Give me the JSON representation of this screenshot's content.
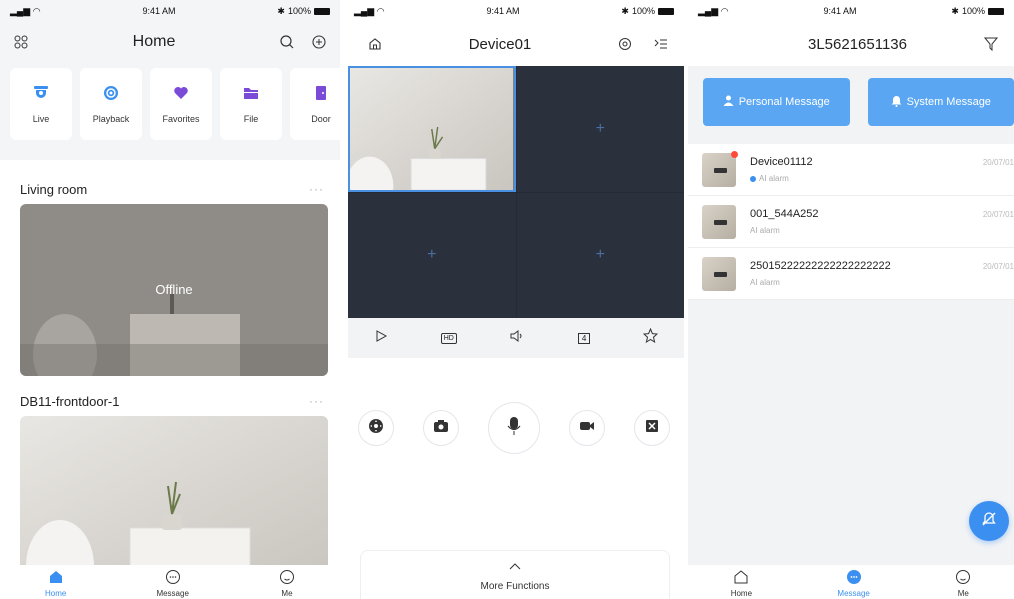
{
  "status": {
    "time": "9:41 AM",
    "battery": "100%"
  },
  "home_screen": {
    "title": "Home",
    "quick_actions": [
      {
        "label": "Live",
        "icon": "camera-icon"
      },
      {
        "label": "Playback",
        "icon": "playback-icon"
      },
      {
        "label": "Favorites",
        "icon": "heart-icon"
      },
      {
        "label": "File",
        "icon": "folder-icon"
      },
      {
        "label": "Door",
        "icon": "door-icon"
      }
    ],
    "groups": [
      {
        "name": "Living room",
        "more": "···",
        "overlay": "Offline"
      },
      {
        "name": "DB11-frontdoor-1",
        "more": "···",
        "overlay": ""
      }
    ],
    "tabs": [
      {
        "label": "Home",
        "icon": "home-icon"
      },
      {
        "label": "Message",
        "icon": "message-icon"
      },
      {
        "label": "Me",
        "icon": "me-icon"
      }
    ]
  },
  "live_screen": {
    "title": "Device01",
    "controls": [
      {
        "icon": "play-icon"
      },
      {
        "icon": "hd-icon",
        "text": "HD"
      },
      {
        "icon": "volume-icon"
      },
      {
        "icon": "split-icon",
        "text": "4"
      },
      {
        "icon": "star-icon"
      }
    ],
    "actions": [
      {
        "icon": "ptz-icon"
      },
      {
        "icon": "snapshot-icon"
      },
      {
        "icon": "microphone-icon"
      },
      {
        "icon": "record-icon"
      },
      {
        "icon": "fullscreen-icon"
      }
    ],
    "more_functions": "More Functions"
  },
  "message_screen": {
    "title": "3L5621651136",
    "buttons": [
      {
        "label": "Personal Message",
        "icon": "person-icon"
      },
      {
        "label": "System Message",
        "icon": "bell-icon"
      }
    ],
    "messages": [
      {
        "device": "Device01112",
        "type": "AI alarm",
        "date": "20/07/01",
        "unread": true
      },
      {
        "device": "001_544A252",
        "type": "AI alarm",
        "date": "20/07/01",
        "unread": false
      },
      {
        "device": "25015222222222222222222",
        "type": "AI alarm",
        "date": "20/07/01",
        "unread": false
      }
    ],
    "tabs": [
      {
        "label": "Home"
      },
      {
        "label": "Message"
      },
      {
        "label": "Me"
      }
    ]
  },
  "colors": {
    "accent": "#3b8ff0",
    "button": "#5aa6f2",
    "grid_bg": "#2a303c"
  }
}
